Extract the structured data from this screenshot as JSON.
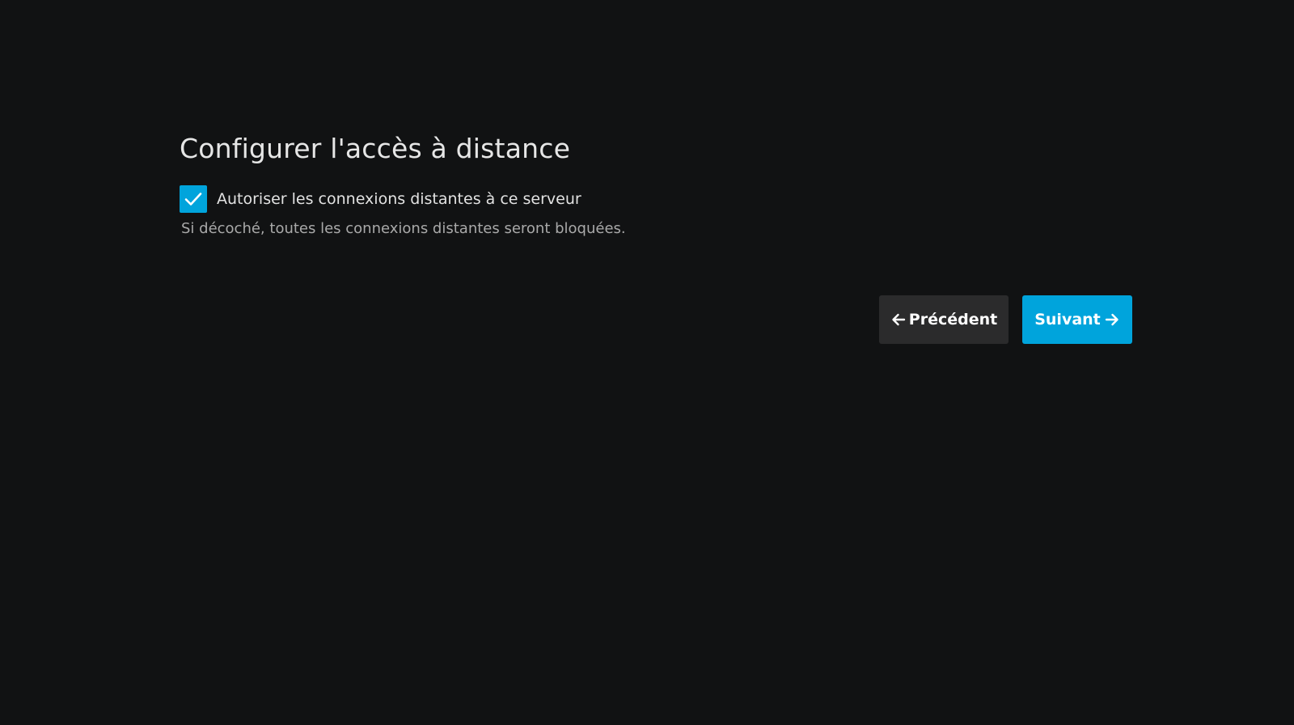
{
  "page": {
    "title": "Configurer l'accès à distance"
  },
  "remote_access": {
    "checkbox_label": "Autoriser les connexions distantes à ce serveur",
    "checked": true,
    "help_text": "Si décoché, toutes les connexions distantes seront bloquées."
  },
  "navigation": {
    "previous_label": "Précédent",
    "previous_icon": "arrow-left-icon",
    "next_label": "Suivant",
    "next_icon": "arrow-right-icon"
  },
  "colors": {
    "background": "#111213",
    "accent": "#00a4dc",
    "secondary_button": "#2b2b2c"
  }
}
